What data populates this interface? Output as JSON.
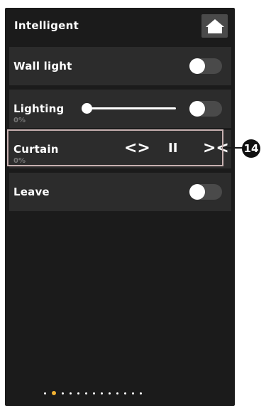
{
  "header": {
    "title": "Intelligent",
    "home_icon": "home-icon"
  },
  "rows": [
    {
      "label": "Wall light",
      "toggle_on": false
    },
    {
      "label": "Lighting",
      "sub": "0%",
      "level": 0.0,
      "toggle_on": false
    },
    {
      "label": "Curtain",
      "sub": "0%",
      "controls": {
        "open": "<>",
        "pause": "II",
        "close": "><"
      }
    },
    {
      "label": "Leave",
      "toggle_on": false
    }
  ],
  "callout": {
    "number": "14"
  },
  "pager": {
    "total": 13,
    "active_index": 1
  },
  "colors": {
    "screen_bg": "#1b1b1b",
    "row_bg": "#2c2c2c",
    "active_dot": "#f2b233",
    "highlight_border": "#c7b0b0"
  }
}
